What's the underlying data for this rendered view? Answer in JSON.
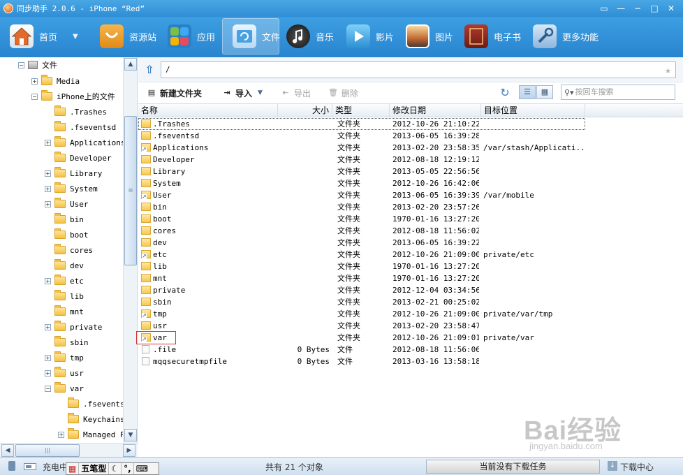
{
  "window": {
    "title": "同步助手 2.0.6 - iPhone “Red”",
    "buttons": [
      "▭",
      "—",
      "−",
      "□",
      "✕"
    ]
  },
  "toolbar": {
    "items": [
      {
        "label": "首页",
        "icon": "home-icon"
      },
      {
        "label": "资源站",
        "icon": "shop-icon"
      },
      {
        "label": "应用",
        "icon": "apps-icon"
      },
      {
        "label": "文件",
        "icon": "files-icon",
        "active": true
      },
      {
        "label": "音乐",
        "icon": "music-icon"
      },
      {
        "label": "影片",
        "icon": "video-icon"
      },
      {
        "label": "图片",
        "icon": "picture-icon"
      },
      {
        "label": "电子书",
        "icon": "ebook-icon"
      },
      {
        "label": "更多功能",
        "icon": "tools-icon"
      }
    ],
    "dropdown_arrow": "▼"
  },
  "sidebar": {
    "root": "文件",
    "media": "Media",
    "iphone_files": "iPhone上的文件",
    "items": [
      ".Trashes",
      ".fseventsd",
      "Applications",
      "Developer",
      "Library",
      "System",
      "User",
      "bin",
      "boot",
      "cores",
      "dev",
      "etc",
      "lib",
      "mnt",
      "private",
      "sbin",
      "tmp",
      "usr",
      "var"
    ],
    "var_children": [
      ".fsevents",
      "Keychains",
      "Managed P:"
    ]
  },
  "address": {
    "path": "/"
  },
  "actions": {
    "new_folder": "新建文件夹",
    "import": "导入",
    "export": "导出",
    "delete": "删除",
    "search_placeholder": "按回车搜索"
  },
  "table": {
    "columns": [
      "名称",
      "大小",
      "类型",
      "修改日期",
      "目标位置"
    ],
    "rows": [
      {
        "name": ".Trashes",
        "size": "",
        "type": "文件夹",
        "date": "2012-10-26 21:10:22",
        "target": "",
        "kind": "folder"
      },
      {
        "name": ".fseventsd",
        "size": "",
        "type": "文件夹",
        "date": "2013-06-05 16:39:28",
        "target": "",
        "kind": "folder"
      },
      {
        "name": "Applications",
        "size": "",
        "type": "文件夹",
        "date": "2013-02-20 23:58:35",
        "target": "/var/stash/Applicati...",
        "kind": "link"
      },
      {
        "name": "Developer",
        "size": "",
        "type": "文件夹",
        "date": "2012-08-18 12:19:12",
        "target": "",
        "kind": "folder"
      },
      {
        "name": "Library",
        "size": "",
        "type": "文件夹",
        "date": "2013-05-05 22:56:56",
        "target": "",
        "kind": "folder"
      },
      {
        "name": "System",
        "size": "",
        "type": "文件夹",
        "date": "2012-10-26 16:42:06",
        "target": "",
        "kind": "folder"
      },
      {
        "name": "User",
        "size": "",
        "type": "文件夹",
        "date": "2013-06-05 16:39:39",
        "target": "/var/mobile",
        "kind": "link"
      },
      {
        "name": "bin",
        "size": "",
        "type": "文件夹",
        "date": "2013-02-20 23:57:26",
        "target": "",
        "kind": "folder"
      },
      {
        "name": "boot",
        "size": "",
        "type": "文件夹",
        "date": "1970-01-16 13:27:20",
        "target": "",
        "kind": "folder"
      },
      {
        "name": "cores",
        "size": "",
        "type": "文件夹",
        "date": "2012-08-18 11:56:02",
        "target": "",
        "kind": "folder"
      },
      {
        "name": "dev",
        "size": "",
        "type": "文件夹",
        "date": "2013-06-05 16:39:22",
        "target": "",
        "kind": "folder"
      },
      {
        "name": "etc",
        "size": "",
        "type": "文件夹",
        "date": "2012-10-26 21:09:00",
        "target": "private/etc",
        "kind": "link"
      },
      {
        "name": "lib",
        "size": "",
        "type": "文件夹",
        "date": "1970-01-16 13:27:20",
        "target": "",
        "kind": "folder"
      },
      {
        "name": "mnt",
        "size": "",
        "type": "文件夹",
        "date": "1970-01-16 13:27:20",
        "target": "",
        "kind": "folder"
      },
      {
        "name": "private",
        "size": "",
        "type": "文件夹",
        "date": "2012-12-04 03:34:56",
        "target": "",
        "kind": "folder"
      },
      {
        "name": "sbin",
        "size": "",
        "type": "文件夹",
        "date": "2013-02-21 00:25:02",
        "target": "",
        "kind": "folder"
      },
      {
        "name": "tmp",
        "size": "",
        "type": "文件夹",
        "date": "2012-10-26 21:09:00",
        "target": "private/var/tmp",
        "kind": "link"
      },
      {
        "name": "usr",
        "size": "",
        "type": "文件夹",
        "date": "2013-02-20 23:58:47",
        "target": "",
        "kind": "folder"
      },
      {
        "name": "var",
        "size": "",
        "type": "文件夹",
        "date": "2012-10-26 21:09:01",
        "target": "private/var",
        "kind": "link"
      },
      {
        "name": ".file",
        "size": "0 Bytes",
        "type": "文件",
        "date": "2012-08-18 11:56:06",
        "target": "",
        "kind": "file"
      },
      {
        "name": "mqqsecuretmpfile",
        "size": "0 Bytes",
        "type": "文件",
        "date": "2013-03-16 13:58:18",
        "target": "",
        "kind": "file"
      }
    ]
  },
  "status": {
    "charge": "充电中",
    "count": "共有 21 个对象",
    "download_status": "当前没有下载任务",
    "download_center": "下载中心"
  },
  "ime": {
    "logo": "▦",
    "name": "五笔型",
    "moon": "☾",
    "punct": "°,",
    "keyboard": "⌨"
  },
  "watermark": {
    "brand": "Bai经验",
    "url": "jingyan.baidu.com"
  },
  "colors": {
    "toolbar": "#2f8ed6",
    "highlight_box": "#d53636"
  }
}
